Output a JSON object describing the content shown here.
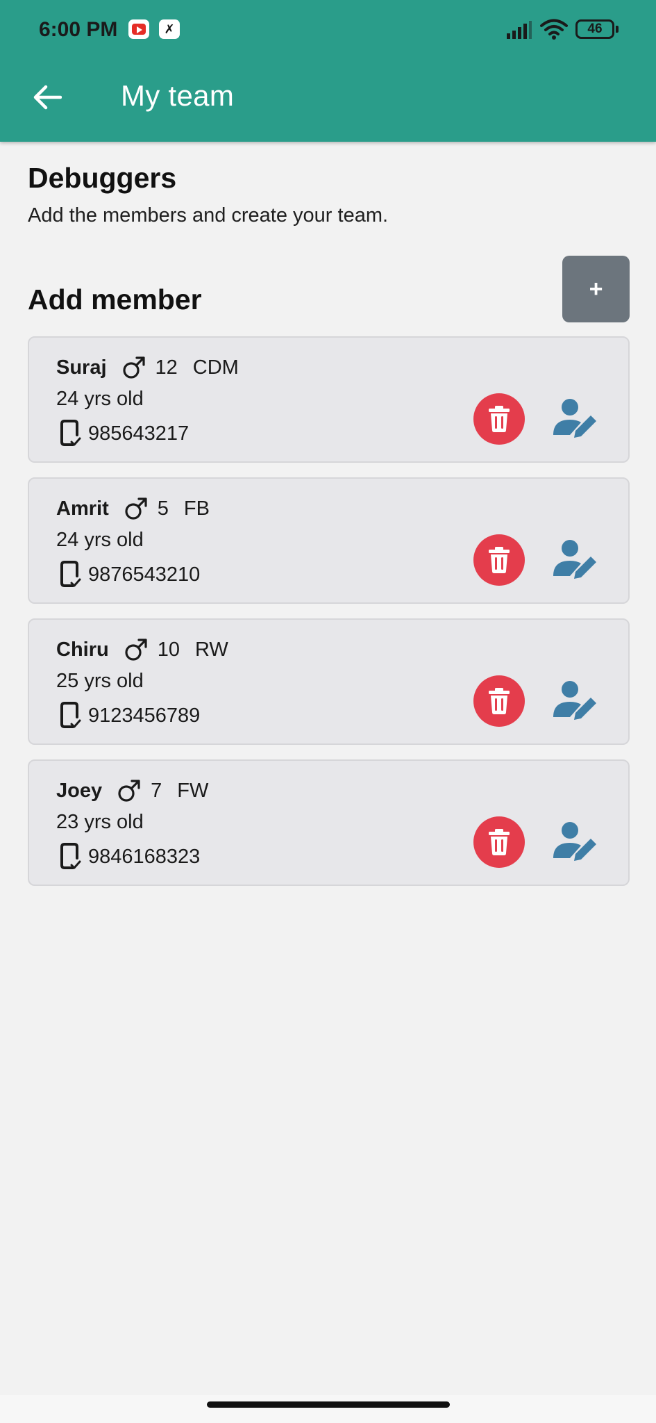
{
  "status_bar": {
    "time": "6:00 PM",
    "battery": "46",
    "icons": [
      "youtube-icon",
      "app-notification-icon",
      "signal-icon",
      "wifi-icon",
      "battery-icon"
    ]
  },
  "app_bar": {
    "title": "My team",
    "background_color": "#2a9d8a",
    "back_icon": "arrow-left-icon"
  },
  "team": {
    "name": "Debuggers",
    "subtitle": "Add the members and create your team."
  },
  "add_member": {
    "title": "Add member",
    "button_label": "+",
    "button_color": "#6c757d"
  },
  "members": [
    {
      "name": "Suraj",
      "gender_icon": "male-icon",
      "number": "12",
      "position": "CDM",
      "age": "24 yrs old",
      "phone": "985643217"
    },
    {
      "name": "Amrit",
      "gender_icon": "male-icon",
      "number": "5",
      "position": "FB",
      "age": "24 yrs old",
      "phone": "9876543210"
    },
    {
      "name": "Chiru",
      "gender_icon": "male-icon",
      "number": "10",
      "position": "RW",
      "age": "25 yrs old",
      "phone": "9123456789"
    },
    {
      "name": "Joey",
      "gender_icon": "male-icon",
      "number": "7",
      "position": "FW",
      "age": "23 yrs old",
      "phone": "9846168323"
    }
  ],
  "colors": {
    "delete": "#e43d4c",
    "edit": "#3f7ea6",
    "card_bg": "#e7e7ea"
  }
}
